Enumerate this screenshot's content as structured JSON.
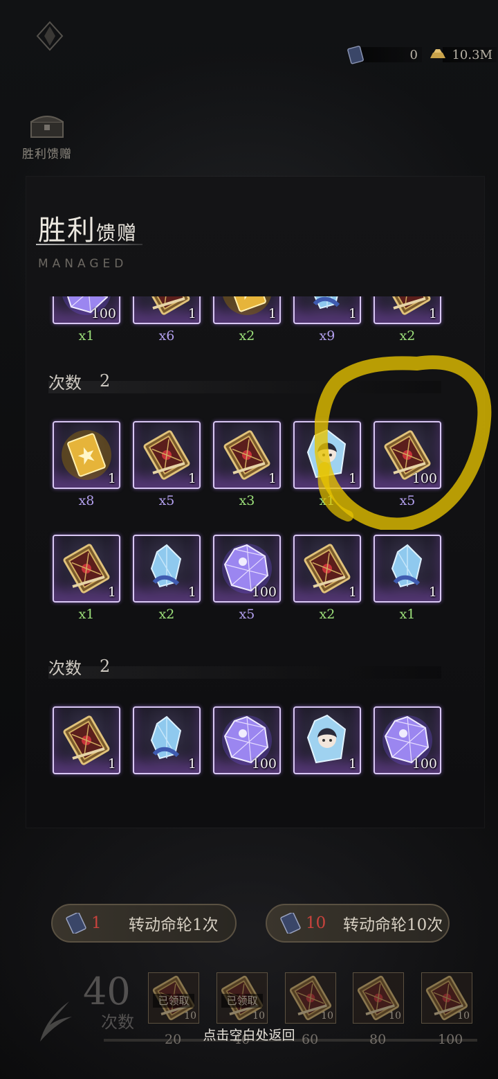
{
  "header": {
    "currency": [
      {
        "icon": "fate-book-icon",
        "value": "0"
      },
      {
        "icon": "gold-ingot-icon",
        "value": "10.3M"
      }
    ],
    "side_button_label": "胜利馈赠"
  },
  "panel": {
    "title_main": "胜利",
    "title_small": "馈赠",
    "subtitle": "MANAGED",
    "top_partial_row": [
      {
        "qty": "100",
        "mult": "x1",
        "mult_color": "green"
      },
      {
        "qty": "1",
        "mult": "x6",
        "mult_color": "purple"
      },
      {
        "qty": "1",
        "mult": "x2",
        "mult_color": "green"
      },
      {
        "qty": "1",
        "mult": "x9",
        "mult_color": "purple"
      },
      {
        "qty": "1",
        "mult": "x2",
        "mult_color": "green"
      }
    ],
    "sections": [
      {
        "label": "次数",
        "count": "2",
        "rows": [
          [
            {
              "icon": "golden-scroll-icon",
              "qty": "1",
              "mult": "x8",
              "mult_color": "purple"
            },
            {
              "icon": "ornate-book-icon",
              "qty": "1",
              "mult": "x5",
              "mult_color": "purple"
            },
            {
              "icon": "ornate-book-icon",
              "qty": "1",
              "mult": "x3",
              "mult_color": "green"
            },
            {
              "icon": "portrait-crystal-icon",
              "qty": "1",
              "mult": "x1",
              "mult_color": "green"
            },
            {
              "icon": "ornate-book-icon",
              "qty": "100",
              "mult": "x5",
              "mult_color": "purple"
            }
          ],
          [
            {
              "icon": "ornate-book-icon",
              "qty": "1",
              "mult": "x1",
              "mult_color": "green"
            },
            {
              "icon": "blue-crystal-icon",
              "qty": "1",
              "mult": "x2",
              "mult_color": "green"
            },
            {
              "icon": "purple-gem-icon",
              "qty": "100",
              "mult": "x5",
              "mult_color": "purple"
            },
            {
              "icon": "ornate-book-icon",
              "qty": "1",
              "mult": "x2",
              "mult_color": "green"
            },
            {
              "icon": "blue-crystal-icon",
              "qty": "1",
              "mult": "x1",
              "mult_color": "green"
            }
          ]
        ]
      },
      {
        "label": "次数",
        "count": "2",
        "rows": [
          [
            {
              "icon": "ornate-book-icon",
              "qty": "1"
            },
            {
              "icon": "blue-crystal-icon",
              "qty": "1"
            },
            {
              "icon": "purple-gem-icon",
              "qty": "100"
            },
            {
              "icon": "portrait-crystal-icon",
              "qty": "1"
            },
            {
              "icon": "purple-gem-icon",
              "qty": "100"
            }
          ]
        ]
      }
    ]
  },
  "actions": {
    "spin_once": {
      "cost": "1",
      "label": "转动命轮1次"
    },
    "spin_ten": {
      "cost": "10",
      "label": "转动命轮10次"
    }
  },
  "progress": {
    "count": "40",
    "count_label": "次数",
    "milestones": [
      {
        "label": "20",
        "qty": "10",
        "status": "已领取"
      },
      {
        "label": "40",
        "qty": "10",
        "status": "已领取"
      },
      {
        "label": "60",
        "qty": "10",
        "status": ""
      },
      {
        "label": "80",
        "qty": "10",
        "status": ""
      },
      {
        "label": "100",
        "qty": "10",
        "status": ""
      }
    ]
  },
  "hint": "点击空白处返回",
  "colors": {
    "mult_green": "#9ce07a",
    "mult_purple": "#b3a0ee",
    "frame_border": "#d9c7f4",
    "highlight": "#e8c400",
    "cost_red": "#c9433d"
  }
}
